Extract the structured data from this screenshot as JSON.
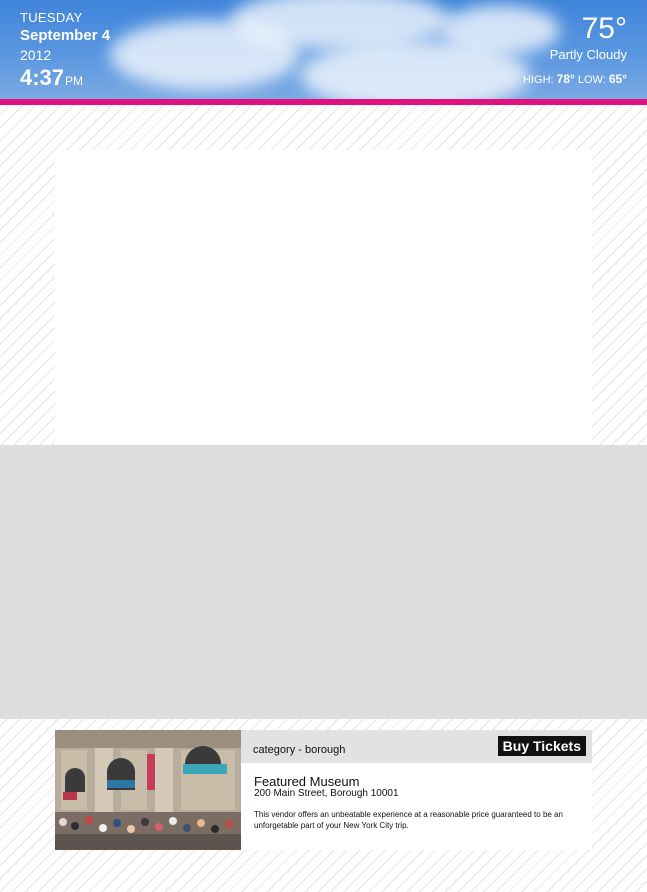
{
  "header": {
    "day": "TUESDAY",
    "month_day": "September 4",
    "year": "2012",
    "time": "4:37",
    "ampm": "PM"
  },
  "weather": {
    "temperature": "75°",
    "condition": "Partly Cloudy",
    "high_label": "HIGH:",
    "high_value": "78°",
    "low_label": "LOW:",
    "low_value": "65°"
  },
  "featured": {
    "category": "category - borough",
    "buy_label": "Buy Tickets",
    "name": "Featured Museum",
    "address": "200 Main Street, Borough 10001",
    "description": "This vendor offers an unbeatable experience at a reasonable price guaranteed to be an unforgetable part of your New York City trip."
  },
  "colors": {
    "accent_bar": "#e0117f",
    "sky": "#4a8ddd",
    "gray_band": "#dcdddf"
  }
}
